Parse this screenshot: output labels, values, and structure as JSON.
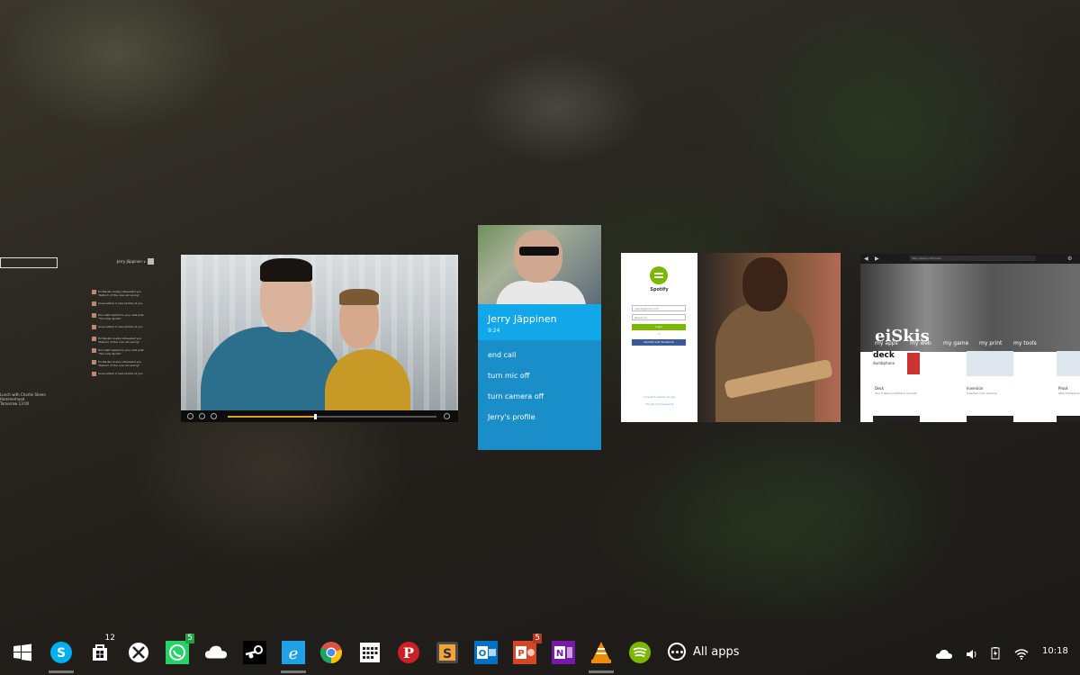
{
  "calendar_window": {
    "user_name": "Jerry Jäppinen ∨",
    "event": "Lunch with Charlie Sheen\nHammerhead\nTomorrow 13:00",
    "feed": [
      "Ed Renato Guzzy retweeted you \"Reform of the rule not wrong\"",
      "Anne added 2 new photos of you",
      "Ron Alait replied to your wall post \"The holy Spirits\"",
      "Anne added 2 new photos of you",
      "Ed Renato Guzzy retweeted you \"Reform of the rule not wrong\"",
      "Ron Alait replied to your wall post \"The holy Spirits\"",
      "Ed Renato Guzzy retweeted you \"Reform of the rule not wrong\"",
      "Anne added 2 new photos of you"
    ]
  },
  "video_player": {
    "progress": 0.42
  },
  "skype_call": {
    "contact_name": "Jerry Jäppinen",
    "duration": "9:24",
    "actions": [
      "end call",
      "turn mic off",
      "turn camera off",
      "Jerry's profile"
    ]
  },
  "spotify": {
    "title": "Spotify",
    "email_value": "eiskis@gmail.com",
    "password_placeholder": "Password",
    "login_label": "Login",
    "or_label": "or",
    "facebook_label": "Identify with Facebook",
    "signup_link": "I haven't signed up yet",
    "forgot_link": "I forgot my password"
  },
  "browser": {
    "url": "http://eiskis.net/tools/",
    "brand": "eiSkis",
    "nav": [
      "my apps",
      "my web",
      "my game",
      "my print",
      "my tools"
    ],
    "tiles": [
      {
        "title": "Deck",
        "subtitle": "Touch device interface concept"
      },
      {
        "title": "Inversion",
        "subtitle": "Inverted color scheme"
      },
      {
        "title": "Proot",
        "subtitle": "Web framework"
      }
    ],
    "deck_label": "deck",
    "deck_sub": "dumbphone"
  },
  "taskbar": {
    "apps": [
      {
        "name": "start",
        "color": "#ffffff"
      },
      {
        "name": "skype",
        "color": "#00aff0"
      },
      {
        "name": "store",
        "color": "#ffffff",
        "badge": "12"
      },
      {
        "name": "xbox",
        "color": "#ffffff"
      },
      {
        "name": "whatsapp",
        "color": "#25d366",
        "badge": "5"
      },
      {
        "name": "onedrive",
        "color": "#ffffff"
      },
      {
        "name": "steam",
        "color": "#ffffff"
      },
      {
        "name": "internet-explorer",
        "color": "#1ea1e6"
      },
      {
        "name": "chrome",
        "color": "#de5145"
      },
      {
        "name": "calendar",
        "color": "#ffffff"
      },
      {
        "name": "pinterest",
        "color": "#cb2027"
      },
      {
        "name": "sublime-text",
        "color": "#f2a33a"
      },
      {
        "name": "outlook",
        "color": "#0072c6"
      },
      {
        "name": "powerpoint",
        "color": "#d24726",
        "badge": "5"
      },
      {
        "name": "onenote",
        "color": "#7719aa"
      },
      {
        "name": "vlc",
        "color": "#f08c00"
      },
      {
        "name": "spotify",
        "color": "#7ab800"
      }
    ],
    "all_apps_label": "All apps",
    "clock": "10:18"
  }
}
